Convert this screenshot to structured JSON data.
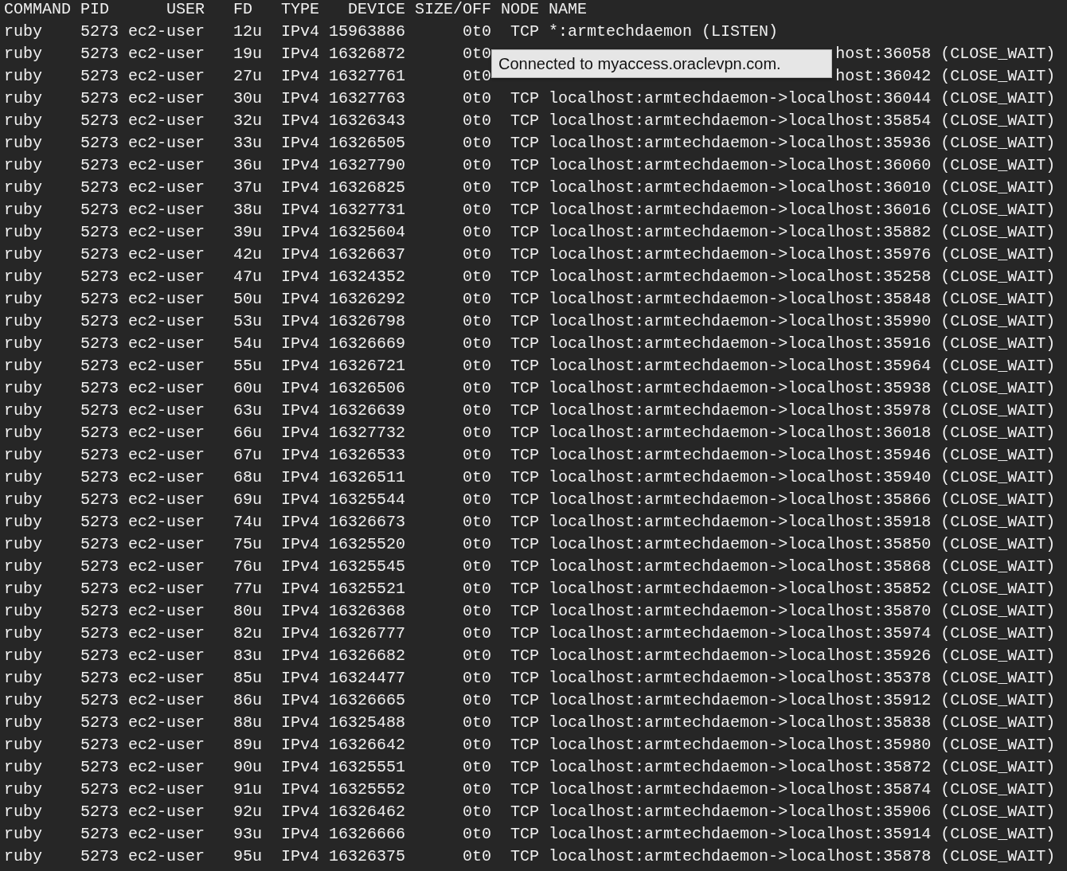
{
  "terminal": {
    "columns": [
      "COMMAND",
      "PID",
      "USER",
      "FD",
      "TYPE",
      "DEVICE",
      "SIZE/OFF",
      "NODE",
      "NAME"
    ],
    "rows": [
      {
        "kind": "full",
        "cells": [
          "ruby",
          "5273",
          "ec2-user",
          "12u",
          "IPv4",
          "15963886",
          "0t0",
          "TCP",
          "*:armtechdaemon (LISTEN)"
        ]
      },
      {
        "kind": "covered",
        "cells": [
          "ruby",
          "5273",
          "ec2-user",
          "19u",
          "IPv4",
          "16326872",
          "0t0",
          "host:36058 (CLOSE_WAIT)"
        ]
      },
      {
        "kind": "covered",
        "cells": [
          "ruby",
          "5273",
          "ec2-user",
          "27u",
          "IPv4",
          "16327761",
          "0t0",
          "host:36042 (CLOSE_WAIT)"
        ]
      },
      {
        "kind": "full",
        "cells": [
          "ruby",
          "5273",
          "ec2-user",
          "30u",
          "IPv4",
          "16327763",
          "0t0",
          "TCP",
          "localhost:armtechdaemon->localhost:36044 (CLOSE_WAIT)"
        ]
      },
      {
        "kind": "full",
        "cells": [
          "ruby",
          "5273",
          "ec2-user",
          "32u",
          "IPv4",
          "16326343",
          "0t0",
          "TCP",
          "localhost:armtechdaemon->localhost:35854 (CLOSE_WAIT)"
        ]
      },
      {
        "kind": "full",
        "cells": [
          "ruby",
          "5273",
          "ec2-user",
          "33u",
          "IPv4",
          "16326505",
          "0t0",
          "TCP",
          "localhost:armtechdaemon->localhost:35936 (CLOSE_WAIT)"
        ]
      },
      {
        "kind": "full",
        "cells": [
          "ruby",
          "5273",
          "ec2-user",
          "36u",
          "IPv4",
          "16327790",
          "0t0",
          "TCP",
          "localhost:armtechdaemon->localhost:36060 (CLOSE_WAIT)"
        ]
      },
      {
        "kind": "full",
        "cells": [
          "ruby",
          "5273",
          "ec2-user",
          "37u",
          "IPv4",
          "16326825",
          "0t0",
          "TCP",
          "localhost:armtechdaemon->localhost:36010 (CLOSE_WAIT)"
        ]
      },
      {
        "kind": "full",
        "cells": [
          "ruby",
          "5273",
          "ec2-user",
          "38u",
          "IPv4",
          "16327731",
          "0t0",
          "TCP",
          "localhost:armtechdaemon->localhost:36016 (CLOSE_WAIT)"
        ]
      },
      {
        "kind": "full",
        "cells": [
          "ruby",
          "5273",
          "ec2-user",
          "39u",
          "IPv4",
          "16325604",
          "0t0",
          "TCP",
          "localhost:armtechdaemon->localhost:35882 (CLOSE_WAIT)"
        ]
      },
      {
        "kind": "full",
        "cells": [
          "ruby",
          "5273",
          "ec2-user",
          "42u",
          "IPv4",
          "16326637",
          "0t0",
          "TCP",
          "localhost:armtechdaemon->localhost:35976 (CLOSE_WAIT)"
        ]
      },
      {
        "kind": "full",
        "cells": [
          "ruby",
          "5273",
          "ec2-user",
          "47u",
          "IPv4",
          "16324352",
          "0t0",
          "TCP",
          "localhost:armtechdaemon->localhost:35258 (CLOSE_WAIT)"
        ]
      },
      {
        "kind": "full",
        "cells": [
          "ruby",
          "5273",
          "ec2-user",
          "50u",
          "IPv4",
          "16326292",
          "0t0",
          "TCP",
          "localhost:armtechdaemon->localhost:35848 (CLOSE_WAIT)"
        ]
      },
      {
        "kind": "full",
        "cells": [
          "ruby",
          "5273",
          "ec2-user",
          "53u",
          "IPv4",
          "16326798",
          "0t0",
          "TCP",
          "localhost:armtechdaemon->localhost:35990 (CLOSE_WAIT)"
        ]
      },
      {
        "kind": "full",
        "cells": [
          "ruby",
          "5273",
          "ec2-user",
          "54u",
          "IPv4",
          "16326669",
          "0t0",
          "TCP",
          "localhost:armtechdaemon->localhost:35916 (CLOSE_WAIT)"
        ]
      },
      {
        "kind": "full",
        "cells": [
          "ruby",
          "5273",
          "ec2-user",
          "55u",
          "IPv4",
          "16326721",
          "0t0",
          "TCP",
          "localhost:armtechdaemon->localhost:35964 (CLOSE_WAIT)"
        ]
      },
      {
        "kind": "full",
        "cells": [
          "ruby",
          "5273",
          "ec2-user",
          "60u",
          "IPv4",
          "16326506",
          "0t0",
          "TCP",
          "localhost:armtechdaemon->localhost:35938 (CLOSE_WAIT)"
        ]
      },
      {
        "kind": "full",
        "cells": [
          "ruby",
          "5273",
          "ec2-user",
          "63u",
          "IPv4",
          "16326639",
          "0t0",
          "TCP",
          "localhost:armtechdaemon->localhost:35978 (CLOSE_WAIT)"
        ]
      },
      {
        "kind": "full",
        "cells": [
          "ruby",
          "5273",
          "ec2-user",
          "66u",
          "IPv4",
          "16327732",
          "0t0",
          "TCP",
          "localhost:armtechdaemon->localhost:36018 (CLOSE_WAIT)"
        ]
      },
      {
        "kind": "full",
        "cells": [
          "ruby",
          "5273",
          "ec2-user",
          "67u",
          "IPv4",
          "16326533",
          "0t0",
          "TCP",
          "localhost:armtechdaemon->localhost:35946 (CLOSE_WAIT)"
        ]
      },
      {
        "kind": "full",
        "cells": [
          "ruby",
          "5273",
          "ec2-user",
          "68u",
          "IPv4",
          "16326511",
          "0t0",
          "TCP",
          "localhost:armtechdaemon->localhost:35940 (CLOSE_WAIT)"
        ]
      },
      {
        "kind": "full",
        "cells": [
          "ruby",
          "5273",
          "ec2-user",
          "69u",
          "IPv4",
          "16325544",
          "0t0",
          "TCP",
          "localhost:armtechdaemon->localhost:35866 (CLOSE_WAIT)"
        ]
      },
      {
        "kind": "full",
        "cells": [
          "ruby",
          "5273",
          "ec2-user",
          "74u",
          "IPv4",
          "16326673",
          "0t0",
          "TCP",
          "localhost:armtechdaemon->localhost:35918 (CLOSE_WAIT)"
        ]
      },
      {
        "kind": "full",
        "cells": [
          "ruby",
          "5273",
          "ec2-user",
          "75u",
          "IPv4",
          "16325520",
          "0t0",
          "TCP",
          "localhost:armtechdaemon->localhost:35850 (CLOSE_WAIT)"
        ]
      },
      {
        "kind": "full",
        "cells": [
          "ruby",
          "5273",
          "ec2-user",
          "76u",
          "IPv4",
          "16325545",
          "0t0",
          "TCP",
          "localhost:armtechdaemon->localhost:35868 (CLOSE_WAIT)"
        ]
      },
      {
        "kind": "full",
        "cells": [
          "ruby",
          "5273",
          "ec2-user",
          "77u",
          "IPv4",
          "16325521",
          "0t0",
          "TCP",
          "localhost:armtechdaemon->localhost:35852 (CLOSE_WAIT)"
        ]
      },
      {
        "kind": "full",
        "cells": [
          "ruby",
          "5273",
          "ec2-user",
          "80u",
          "IPv4",
          "16326368",
          "0t0",
          "TCP",
          "localhost:armtechdaemon->localhost:35870 (CLOSE_WAIT)"
        ]
      },
      {
        "kind": "full",
        "cells": [
          "ruby",
          "5273",
          "ec2-user",
          "82u",
          "IPv4",
          "16326777",
          "0t0",
          "TCP",
          "localhost:armtechdaemon->localhost:35974 (CLOSE_WAIT)"
        ]
      },
      {
        "kind": "full",
        "cells": [
          "ruby",
          "5273",
          "ec2-user",
          "83u",
          "IPv4",
          "16326682",
          "0t0",
          "TCP",
          "localhost:armtechdaemon->localhost:35926 (CLOSE_WAIT)"
        ]
      },
      {
        "kind": "full",
        "cells": [
          "ruby",
          "5273",
          "ec2-user",
          "85u",
          "IPv4",
          "16324477",
          "0t0",
          "TCP",
          "localhost:armtechdaemon->localhost:35378 (CLOSE_WAIT)"
        ]
      },
      {
        "kind": "full",
        "cells": [
          "ruby",
          "5273",
          "ec2-user",
          "86u",
          "IPv4",
          "16326665",
          "0t0",
          "TCP",
          "localhost:armtechdaemon->localhost:35912 (CLOSE_WAIT)"
        ]
      },
      {
        "kind": "full",
        "cells": [
          "ruby",
          "5273",
          "ec2-user",
          "88u",
          "IPv4",
          "16325488",
          "0t0",
          "TCP",
          "localhost:armtechdaemon->localhost:35838 (CLOSE_WAIT)"
        ]
      },
      {
        "kind": "full",
        "cells": [
          "ruby",
          "5273",
          "ec2-user",
          "89u",
          "IPv4",
          "16326642",
          "0t0",
          "TCP",
          "localhost:armtechdaemon->localhost:35980 (CLOSE_WAIT)"
        ]
      },
      {
        "kind": "full",
        "cells": [
          "ruby",
          "5273",
          "ec2-user",
          "90u",
          "IPv4",
          "16325551",
          "0t0",
          "TCP",
          "localhost:armtechdaemon->localhost:35872 (CLOSE_WAIT)"
        ]
      },
      {
        "kind": "full",
        "cells": [
          "ruby",
          "5273",
          "ec2-user",
          "91u",
          "IPv4",
          "16325552",
          "0t0",
          "TCP",
          "localhost:armtechdaemon->localhost:35874 (CLOSE_WAIT)"
        ]
      },
      {
        "kind": "full",
        "cells": [
          "ruby",
          "5273",
          "ec2-user",
          "92u",
          "IPv4",
          "16326462",
          "0t0",
          "TCP",
          "localhost:armtechdaemon->localhost:35906 (CLOSE_WAIT)"
        ]
      },
      {
        "kind": "full",
        "cells": [
          "ruby",
          "5273",
          "ec2-user",
          "93u",
          "IPv4",
          "16326666",
          "0t0",
          "TCP",
          "localhost:armtechdaemon->localhost:35914 (CLOSE_WAIT)"
        ]
      },
      {
        "kind": "full",
        "cells": [
          "ruby",
          "5273",
          "ec2-user",
          "95u",
          "IPv4",
          "16326375",
          "0t0",
          "TCP",
          "localhost:armtechdaemon->localhost:35878 (CLOSE_WAIT)"
        ]
      }
    ]
  },
  "tooltip": {
    "text": "Connected to myaccess.oraclevpn.com."
  }
}
